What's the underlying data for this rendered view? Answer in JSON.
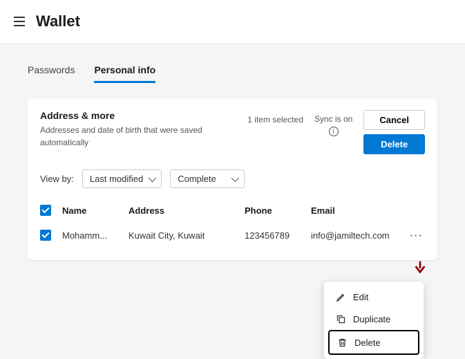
{
  "page": {
    "title": "Wallet"
  },
  "tabs": {
    "passwords": "Passwords",
    "personal": "Personal info"
  },
  "section": {
    "title": "Address & more",
    "description": "Addresses and date of birth that were saved automatically",
    "selection": "1 item selected",
    "sync_label": "Sync is on"
  },
  "buttons": {
    "cancel": "Cancel",
    "delete": "Delete"
  },
  "view": {
    "label": "View by:",
    "sort": "Last modified",
    "filter": "Complete"
  },
  "table": {
    "headers": {
      "name": "Name",
      "address": "Address",
      "phone": "Phone",
      "email": "Email"
    },
    "row": {
      "name": "Mohamm...",
      "address": "Kuwait City, Kuwait",
      "phone": "123456789",
      "email": "info@jamiltech.com"
    }
  },
  "menu": {
    "edit": "Edit",
    "duplicate": "Duplicate",
    "delete": "Delete"
  }
}
